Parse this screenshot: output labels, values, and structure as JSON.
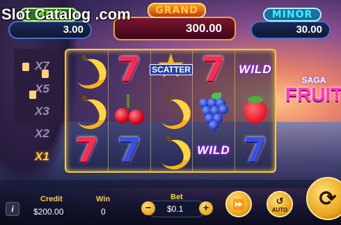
{
  "watermark": "Slot Catalog .com",
  "jackpots": {
    "mini": {
      "title": "MINI",
      "value": "3.00"
    },
    "grand": {
      "title": "GRAND",
      "value": "300.00"
    },
    "minor": {
      "title": "MINOR",
      "value": "30.00"
    }
  },
  "multipliers": [
    "X7",
    "X5",
    "X3",
    "X2",
    "X1"
  ],
  "active_multiplier": "X1",
  "reels": [
    [
      "banana",
      "banana",
      "seven-red"
    ],
    [
      "seven-red",
      "cherry",
      "seven-blue"
    ],
    [
      "scatter",
      "banana",
      "banana"
    ],
    [
      "seven-red",
      "grape",
      "wild"
    ],
    [
      "wild",
      "strawberry",
      "seven-blue"
    ]
  ],
  "symbol_text": {
    "seven": "7",
    "wild": "WILD",
    "scatter": "SCATTER"
  },
  "game_logo": {
    "line1": "SAGA",
    "line2": "FRUITS"
  },
  "bottom": {
    "info_label": "i",
    "credit_label": "Credit",
    "credit_value": "$200.00",
    "win_label": "Win",
    "win_value": "0",
    "bet_label": "Bet",
    "bet_value": "$0.1",
    "minus": "−",
    "plus": "+",
    "auto_label": "AUTO"
  },
  "colors": {
    "accent": "#ffd23a",
    "frame": "#f4c84a"
  }
}
